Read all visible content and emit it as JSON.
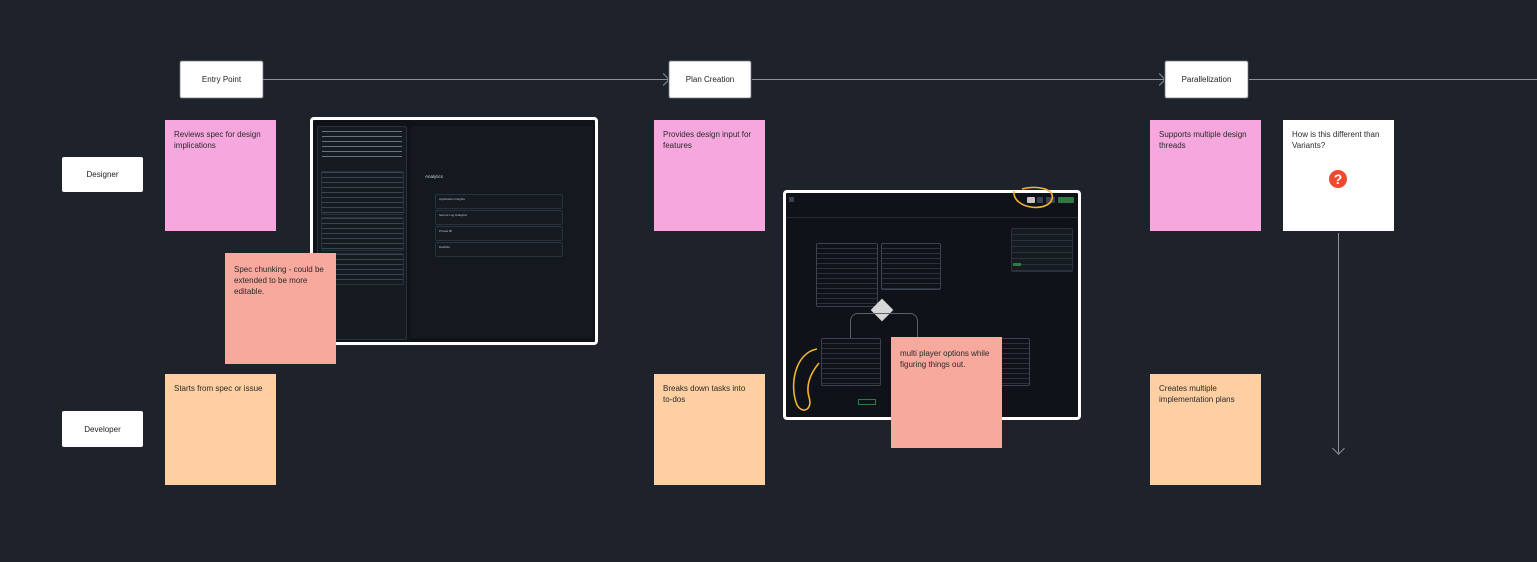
{
  "diagram": {
    "faint_title": "",
    "stages": [
      {
        "label": "Entry Point"
      },
      {
        "label": "Plan Creation"
      },
      {
        "label": "Parallelization"
      }
    ],
    "roles": [
      {
        "label": "Designer"
      },
      {
        "label": "Developer"
      }
    ],
    "stickies": {
      "designer_entry": "Reviews spec for design implications",
      "spec_chunking": "Spec chunking - could be extended to be more editable.",
      "developer_entry": "Starts from spec or issue",
      "designer_plan": "Provides design input for features",
      "developer_plan": "Breaks down tasks into to-dos",
      "multiplayer": "multi player options while figuring things out.",
      "designer_parallel": "Supports multiple design threads",
      "question": "How is this different than Variants?",
      "developer_parallel": "Creates multiple implementation plans"
    },
    "question_mark": "?"
  },
  "screenshot1": {
    "analytics_title": "Analytics",
    "items": [
      "Application Insights",
      "Secure Log Analytics",
      "Private BI",
      "Dashbio"
    ]
  },
  "colors": {
    "background": "#1e222a",
    "pink": "#f6a7dd",
    "peach": "#fdcfa2",
    "salmon": "#f7a99d",
    "annotation": "#f2b330",
    "question": "#f0492e"
  }
}
